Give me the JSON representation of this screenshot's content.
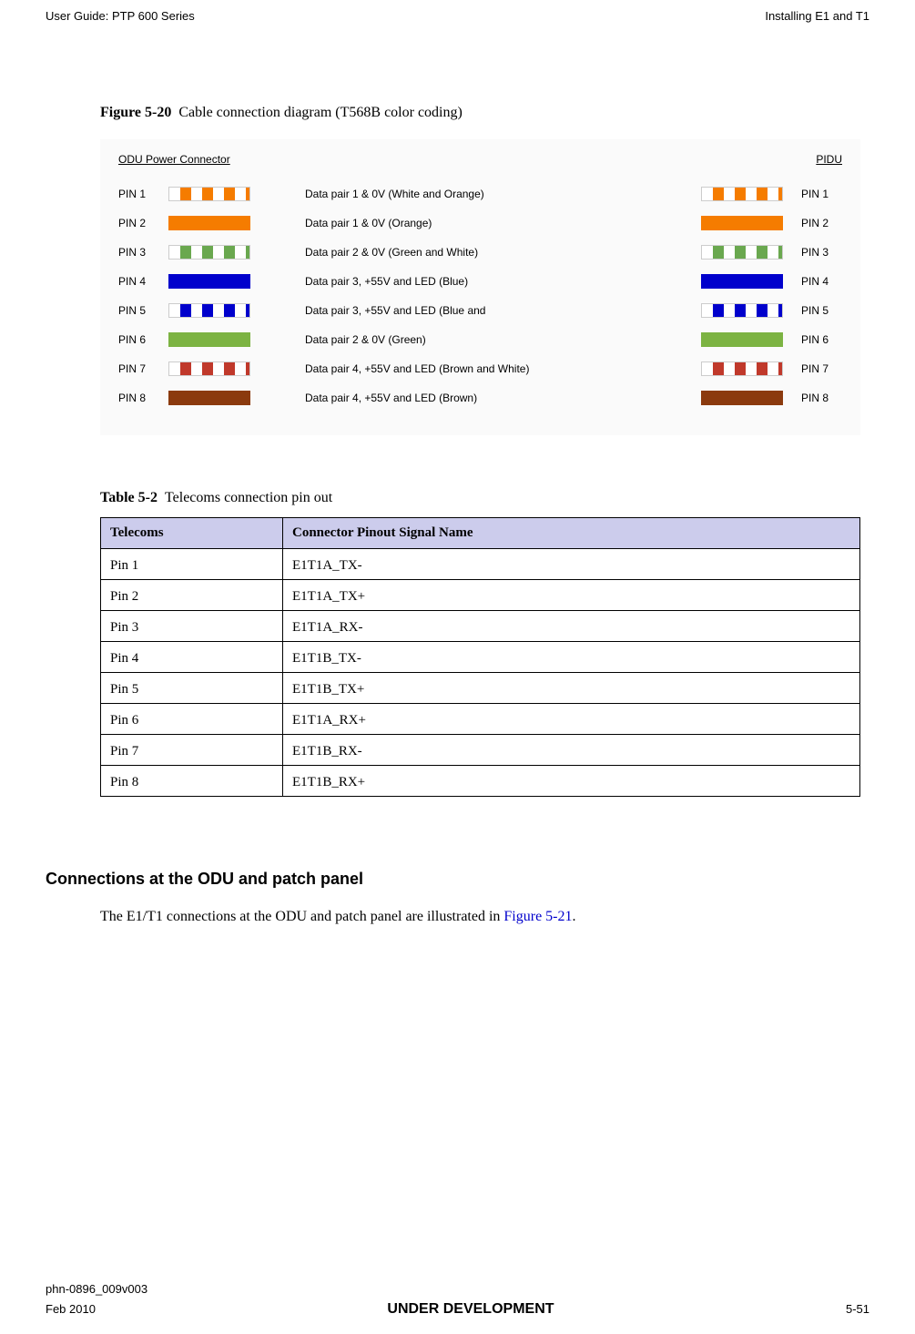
{
  "header": {
    "left": "User Guide: PTP 600 Series",
    "right": "Installing E1 and T1"
  },
  "figure": {
    "label": "Figure 5-20",
    "caption": "Cable connection diagram (T568B color coding)",
    "left_title": "ODU Power Connector",
    "right_title": "PIDU",
    "rows": [
      {
        "left_pin": "PIN 1",
        "desc": "Data pair 1 & 0V (White and Orange)",
        "right_pin": "PIN 1"
      },
      {
        "left_pin": "PIN 2",
        "desc": "Data pair 1 & 0V (Orange)",
        "right_pin": "PIN 2"
      },
      {
        "left_pin": "PIN 3",
        "desc": "Data pair 2 & 0V (Green and White)",
        "right_pin": "PIN 3"
      },
      {
        "left_pin": "PIN 4",
        "desc": "Data pair 3, +55V and LED (Blue)",
        "right_pin": "PIN 4"
      },
      {
        "left_pin": "PIN 5",
        "desc": "Data pair 3, +55V and LED (Blue and",
        "right_pin": "PIN 5"
      },
      {
        "left_pin": "PIN 6",
        "desc": "Data pair 2 & 0V (Green)",
        "right_pin": "PIN 6"
      },
      {
        "left_pin": "PIN 7",
        "desc": "Data pair 4, +55V and LED (Brown and White)",
        "right_pin": "PIN 7"
      },
      {
        "left_pin": "PIN 8",
        "desc": "Data pair 4, +55V and LED (Brown)",
        "right_pin": "PIN 8"
      }
    ]
  },
  "table": {
    "label": "Table 5-2",
    "caption": "Telecoms connection pin out",
    "headers": {
      "col1": "Telecoms",
      "col2": "Connector Pinout Signal Name"
    },
    "rows": [
      {
        "pin": "Pin 1",
        "signal": "E1T1A_TX-"
      },
      {
        "pin": "Pin 2",
        "signal": "E1T1A_TX+"
      },
      {
        "pin": "Pin 3",
        "signal": "E1T1A_RX-"
      },
      {
        "pin": "Pin 4",
        "signal": "E1T1B_TX-"
      },
      {
        "pin": "Pin 5",
        "signal": "E1T1B_TX+"
      },
      {
        "pin": "Pin 6",
        "signal": "E1T1A_RX+"
      },
      {
        "pin": "Pin 7",
        "signal": "E1T1B_RX-"
      },
      {
        "pin": "Pin 8",
        "signal": "E1T1B_RX+"
      }
    ]
  },
  "section": {
    "heading": "Connections at the ODU and patch panel",
    "body_pre": "The E1/T1 connections at the ODU and patch panel are illustrated in ",
    "body_link": "Figure 5-21",
    "body_post": "."
  },
  "footer": {
    "doc_id": "phn-0896_009v003",
    "date": "Feb 2010",
    "status": "UNDER DEVELOPMENT",
    "page": "5-51"
  }
}
